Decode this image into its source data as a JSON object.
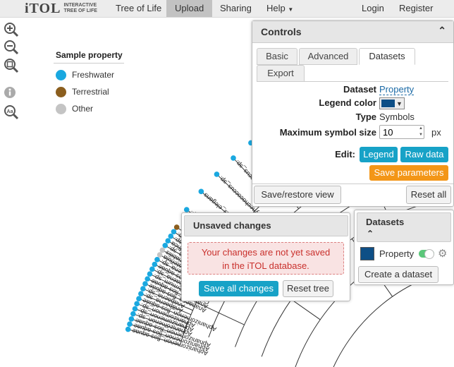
{
  "navbar": {
    "logo_main": "iTOL",
    "logo_sub_1": "INTERACTIVE",
    "logo_sub_2": "TREE OF LIFE",
    "items": [
      "Tree of Life",
      "Upload",
      "Sharing",
      "Help"
    ],
    "active": "Upload",
    "login": "Login",
    "register": "Register"
  },
  "tools": [
    "zoom-in-icon",
    "zoom-out-icon",
    "zoom-fit-icon",
    "info-icon",
    "font-size-icon"
  ],
  "legend": {
    "title": "Sample property",
    "items": [
      {
        "label": "Freshwater",
        "color": "#1aa8e0"
      },
      {
        "label": "Terrestrial",
        "color": "#8b5e1e"
      },
      {
        "label": "Other",
        "color": "#c4c4c4"
      }
    ]
  },
  "tree": {
    "upper_labels": [
      "Synechococcus_sp.",
      "Synechocystis_elegans",
      "Synechococcus_sp.",
      "Synechococcus_sp.",
      "Limnothrix_sp.",
      "Leptolyngbya_sp.",
      "Pseudanabaena_sp.",
      "Pseudanabaena_sp.",
      "Planktothrix_sp.",
      "Oscillatoria_sp.",
      "Phormidium_sp.",
      "Geitlerinema_sp.",
      "Symploca_sp.",
      "Lyngbya_sp."
    ],
    "lower_labels": [
      "Aphanizomenon_flos-aquae",
      "Aphanizomenon_flos-aquae",
      "Aphanizomenon_flos-aquae",
      "Aphanizomenon_sp.",
      "Aphanizomenon_sp.",
      "Aphanizomenon_sp.",
      "Aphanizomenon_flos-aquae",
      "Anabaena_sp.",
      "Anabaena_sp.",
      "Anabaena_flos-aquae",
      "Anabaena_flos-aquae",
      "Cylindrospermum_sp.",
      "Anabaena_sp.",
      "Anabaena_flos-aquae",
      "Anabaena_sp.",
      "Anabaena_catenula",
      "Anabaena_variabilis",
      "Anabaena_sp.",
      "Anabaena_cylindrica",
      "Anabaena_sp.",
      "Cylindrospermum_sp.",
      "Sphaerospermopsis_sp."
    ]
  },
  "controls": {
    "title": "Controls",
    "tabs": [
      "Basic",
      "Advanced",
      "Datasets",
      "Export"
    ],
    "active_tab": "Datasets",
    "dataset_label": "Dataset",
    "dataset_value": "Property",
    "legend_color_label": "Legend color",
    "legend_color": "#0e4f86",
    "type_label": "Type",
    "type_value": "Symbols",
    "max_size_label": "Maximum symbol size",
    "max_size_value": "10",
    "max_size_unit": "px",
    "edit_label": "Edit:",
    "legend_button": "Legend",
    "raw_data_button": "Raw data",
    "save_params_button": "Save parameters",
    "save_restore_button": "Save/restore view",
    "reset_all_button": "Reset all"
  },
  "unsaved": {
    "title": "Unsaved changes",
    "message_1": "Your changes are not yet saved",
    "message_2": "in the iTOL database.",
    "save_all_button": "Save all changes",
    "reset_tree_button": "Reset tree"
  },
  "datasets_panel": {
    "title": "Datasets",
    "item_label": "Property",
    "item_color": "#0e4f86",
    "create_button": "Create a dataset"
  }
}
